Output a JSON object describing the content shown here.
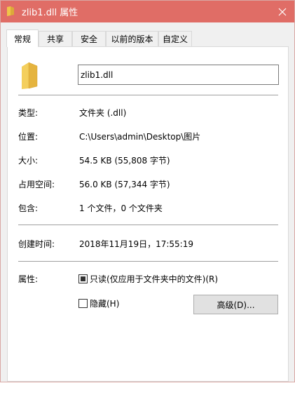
{
  "window": {
    "title": "zlib1.dll 属性"
  },
  "tabs": [
    {
      "label": "常规",
      "active": true
    },
    {
      "label": "共享",
      "active": false
    },
    {
      "label": "安全",
      "active": false
    },
    {
      "label": "以前的版本",
      "active": false
    },
    {
      "label": "自定义",
      "active": false
    }
  ],
  "general": {
    "name_value": "zlib1.dll",
    "type_label": "类型:",
    "type_value": "文件夹 (.dll)",
    "location_label": "位置:",
    "location_value": "C:\\Users\\admin\\Desktop\\图片",
    "size_label": "大小:",
    "size_value": "54.5 KB (55,808 字节)",
    "size_on_disk_label": "占用空间:",
    "size_on_disk_value": "56.0 KB (57,344 字节)",
    "contains_label": "包含:",
    "contains_value": "1 个文件，0 个文件夹",
    "created_label": "创建时间:",
    "created_value": "2018年11月19日，17:55:19",
    "attributes_label": "属性:",
    "readonly_label": "只读(仅应用于文件夹中的文件)(R)",
    "readonly_state": "indeterminate",
    "hidden_label": "隐藏(H)",
    "hidden_checked": false,
    "advanced_button": "高级(D)..."
  },
  "icons": {
    "title_icon": "folder-icon",
    "close_icon": "close-icon",
    "large_icon": "folder-icon"
  },
  "colors": {
    "titlebar": "#e06d66",
    "folder": "#f0c449",
    "panel": "#ffffff",
    "client": "#f0f0f0"
  }
}
